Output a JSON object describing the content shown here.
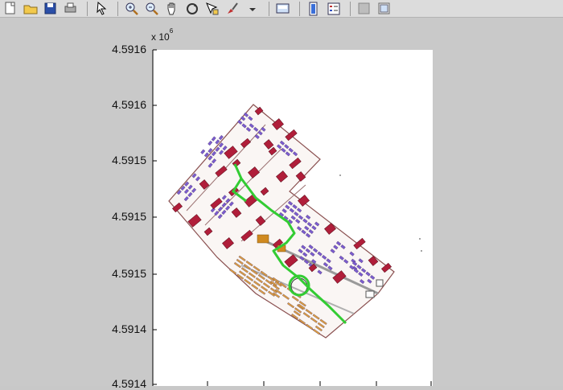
{
  "toolbar": {
    "buttons": [
      {
        "icon": "new-figure-icon"
      },
      {
        "icon": "open-file-icon"
      },
      {
        "icon": "save-icon"
      },
      {
        "icon": "print-icon"
      },
      {
        "sep": true
      },
      {
        "icon": "pointer-icon"
      },
      {
        "sep": true
      },
      {
        "icon": "zoom-in-icon"
      },
      {
        "icon": "zoom-out-icon"
      },
      {
        "icon": "pan-hand-icon"
      },
      {
        "icon": "rotate-3d-icon"
      },
      {
        "icon": "data-cursor-icon"
      },
      {
        "icon": "brush-icon"
      },
      {
        "icon": "dropdown-arrow-icon"
      },
      {
        "sep": true
      },
      {
        "icon": "link-plot-icon"
      },
      {
        "sep": true
      },
      {
        "icon": "colorbar-icon"
      },
      {
        "icon": "legend-icon"
      },
      {
        "sep": true
      },
      {
        "icon": "hide-plot-tools-icon"
      },
      {
        "icon": "show-plot-tools-icon"
      }
    ]
  },
  "axes": {
    "exponent_base": "x 10",
    "exponent_power": "6",
    "y_tick_labels": [
      "4.5916",
      "4.5916",
      "4.5915",
      "4.5915",
      "4.5915",
      "4.5914",
      "4.5914"
    ]
  },
  "colors": {
    "background": "#c9c9c9",
    "plot_background": "#ffffff",
    "building_red": "#b01e3a",
    "parking_purple": "#7a5ccf",
    "route_green": "#33cc33",
    "parcel_orange": "#e0a040",
    "outline": "#8a5050"
  }
}
